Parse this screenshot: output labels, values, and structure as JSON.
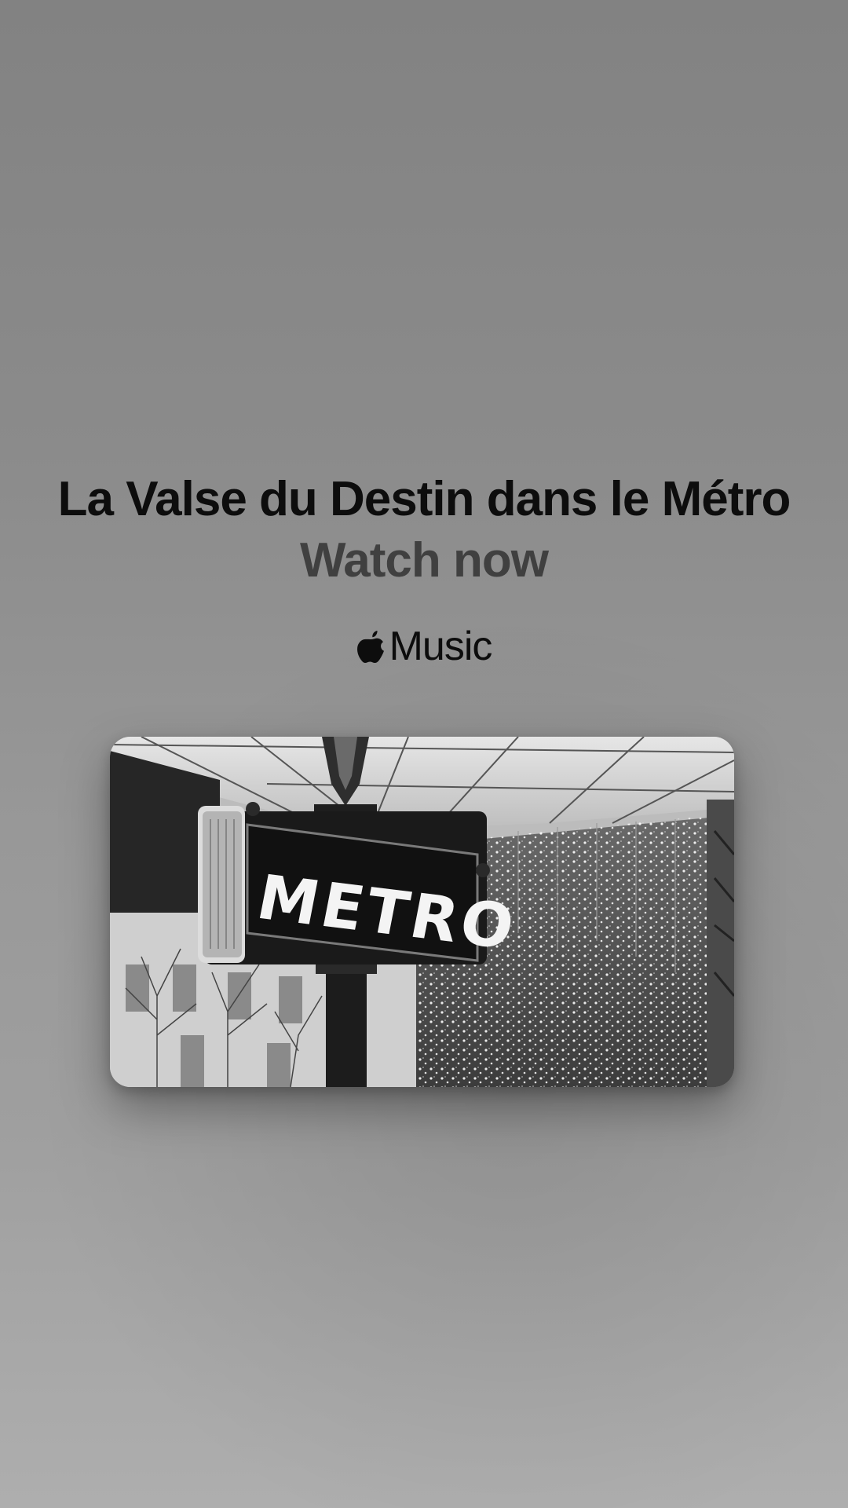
{
  "title": "La Valse du Destin dans le Métro",
  "subtitle": "Watch now",
  "brand": {
    "icon": "apple-logo-icon",
    "label": "Music"
  },
  "artwork": {
    "sign_text": "METRO"
  }
}
